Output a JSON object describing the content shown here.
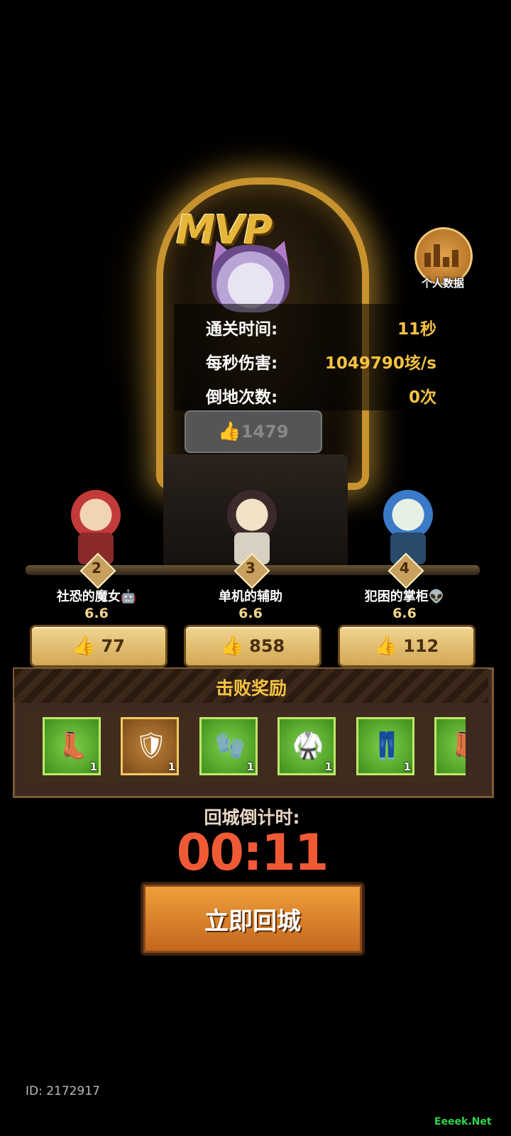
{
  "mvp": {
    "badge": "MVP",
    "stats": [
      {
        "label": "通关时间:",
        "value": "11秒"
      },
      {
        "label": "每秒伤害:",
        "value": "1049790垓/s"
      },
      {
        "label": "倒地次数:",
        "value": "0次"
      }
    ],
    "likes": "1479"
  },
  "personal_data": {
    "label": "个人数据",
    "icon": "bar-chart-icon"
  },
  "players": [
    {
      "rank": "2",
      "name": "社恐的魔女🤖",
      "score": "6.6",
      "likes": "77"
    },
    {
      "rank": "3",
      "name": "单机的辅助",
      "score": "6.6",
      "likes": "858"
    },
    {
      "rank": "4",
      "name": "犯困的掌柜👽",
      "score": "6.6",
      "likes": "112"
    }
  ],
  "rewards": {
    "title": "击败奖励",
    "items": [
      {
        "icon": "boots-icon",
        "count": "1",
        "rarity": "green"
      },
      {
        "icon": "shoulder-armor-icon",
        "count": "1",
        "rarity": "gold"
      },
      {
        "icon": "gauntlet-icon",
        "count": "1",
        "rarity": "green"
      },
      {
        "icon": "chest-armor-icon",
        "count": "1",
        "rarity": "green"
      },
      {
        "icon": "leg-armor-icon",
        "count": "1",
        "rarity": "green"
      },
      {
        "icon": "boots-icon",
        "count": "",
        "rarity": "green"
      }
    ]
  },
  "countdown": {
    "label": "回城倒计时:",
    "time": "00:11"
  },
  "return_button": "立即回城",
  "player_id": "ID: 2172917",
  "watermark": "Eeeek.Net",
  "colors": {
    "accent_gold": "#f5c342",
    "countdown_red": "#ef5a35",
    "button_orange": "#e0892e"
  }
}
